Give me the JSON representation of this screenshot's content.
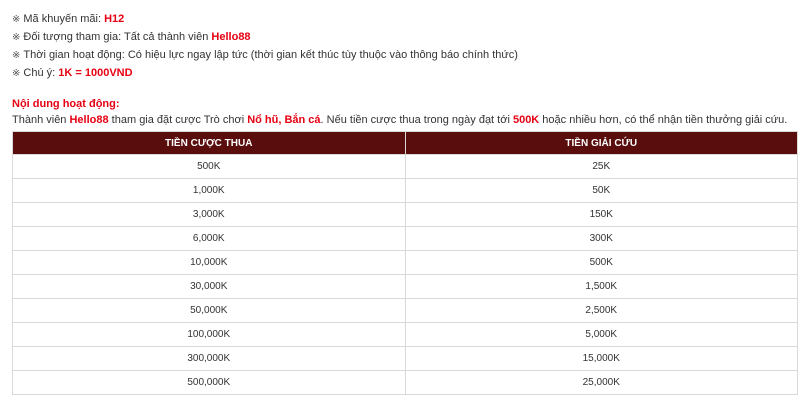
{
  "info": {
    "promo_code_label": "Mã khuyến mãi: ",
    "promo_code_value": "H12",
    "target_label": "Đối tượng tham gia: Tất cả thành viên ",
    "target_value": "Hello88",
    "time_label": "Thời gian hoạt động: Có hiệu lực ngay lập tức (thời gian kết thúc tùy thuộc vào thông báo chính thức)",
    "note_label": "Chú ý: ",
    "note_value": "1K = 1000VND",
    "bullet": "※"
  },
  "activity": {
    "title": "Nội dung hoạt động:",
    "desc_part1": "Thành viên ",
    "desc_brand": "Hello88",
    "desc_part2": " tham gia đặt cược Trò chơi ",
    "desc_games": "Nổ hũ, Bắn cá",
    "desc_part3": ". Nếu tiền cược thua trong ngày đạt tới ",
    "desc_amount": "500K",
    "desc_part4": " hoặc nhiều hơn, có thể nhận tiền thưởng giải cứu."
  },
  "table": {
    "headers": [
      "Tiền cược thua",
      "Tiền giải cứu"
    ],
    "rows": [
      [
        "500K",
        "25K"
      ],
      [
        "1,000K",
        "50K"
      ],
      [
        "3,000K",
        "150K"
      ],
      [
        "6,000K",
        "300K"
      ],
      [
        "10,000K",
        "500K"
      ],
      [
        "30,000K",
        "1,500K"
      ],
      [
        "50,000K",
        "2,500K"
      ],
      [
        "100,000K",
        "5,000K"
      ],
      [
        "300,000K",
        "15,000K"
      ],
      [
        "500,000K",
        "25,000K"
      ]
    ]
  },
  "colors": {
    "accent_red": "#e60012",
    "header_bg": "#5a0d0d"
  }
}
